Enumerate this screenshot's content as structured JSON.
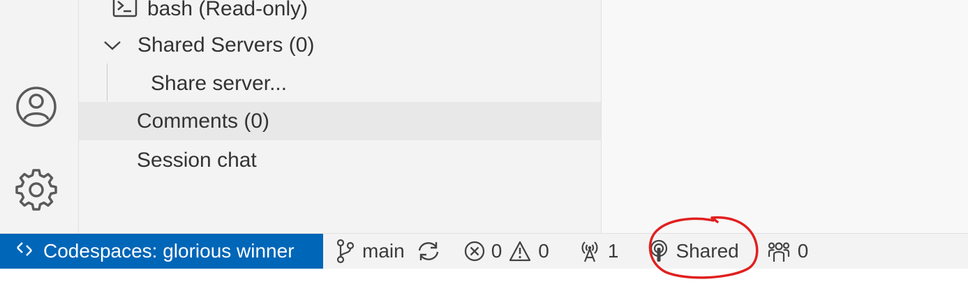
{
  "sidebar": {
    "items": [
      {
        "label": "bash (Read-only)"
      },
      {
        "label": "Shared Servers (0)"
      },
      {
        "label": "Share server..."
      },
      {
        "label": "Comments (0)"
      },
      {
        "label": "Session chat"
      }
    ]
  },
  "activity_bar": {
    "icons": [
      "account-icon",
      "settings-gear-icon"
    ]
  },
  "statusbar": {
    "remote_label": "Codespaces: glorious winner",
    "branch": "main",
    "errors": "0",
    "warnings": "0",
    "ports": "1",
    "live_share": "Shared",
    "participants": "0",
    "colors": {
      "remote_bg": "#0066b8",
      "annotation": "#e0201e"
    }
  }
}
